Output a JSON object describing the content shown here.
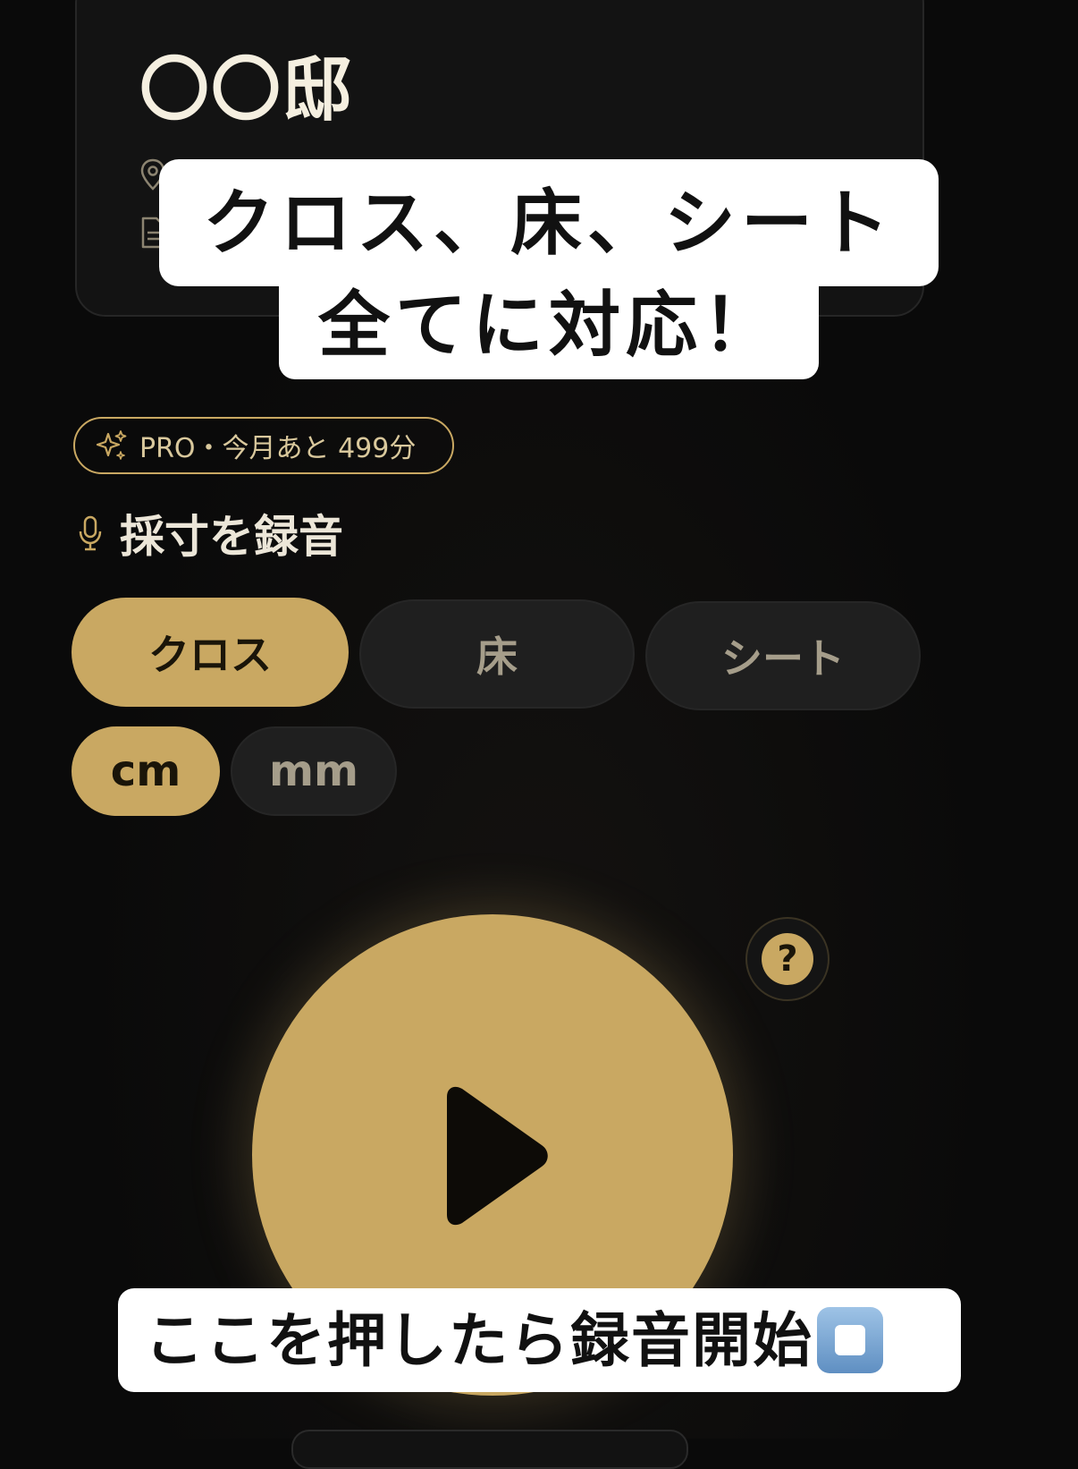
{
  "project": {
    "title": "〇〇邸"
  },
  "captions": {
    "top_line1": "クロス、床、シート",
    "top_line2": "全てに対応！",
    "bottom": "ここを押したら録音開始"
  },
  "pro_badge": {
    "icon": "sparkles-icon",
    "text": "PRO・今月あと 499分"
  },
  "section": {
    "icon": "microphone-icon",
    "title": "採寸を録音"
  },
  "materials": [
    {
      "label": "クロス",
      "selected": true
    },
    {
      "label": "床",
      "selected": false
    },
    {
      "label": "シート",
      "selected": false
    }
  ],
  "units": [
    {
      "label": "cm",
      "selected": true
    },
    {
      "label": "mm",
      "selected": false
    }
  ],
  "help": {
    "label": "?"
  },
  "colors": {
    "accent": "#c9a862",
    "background": "#0a0a0a",
    "card": "#131313",
    "pill_inactive": "#1f1f1f"
  }
}
